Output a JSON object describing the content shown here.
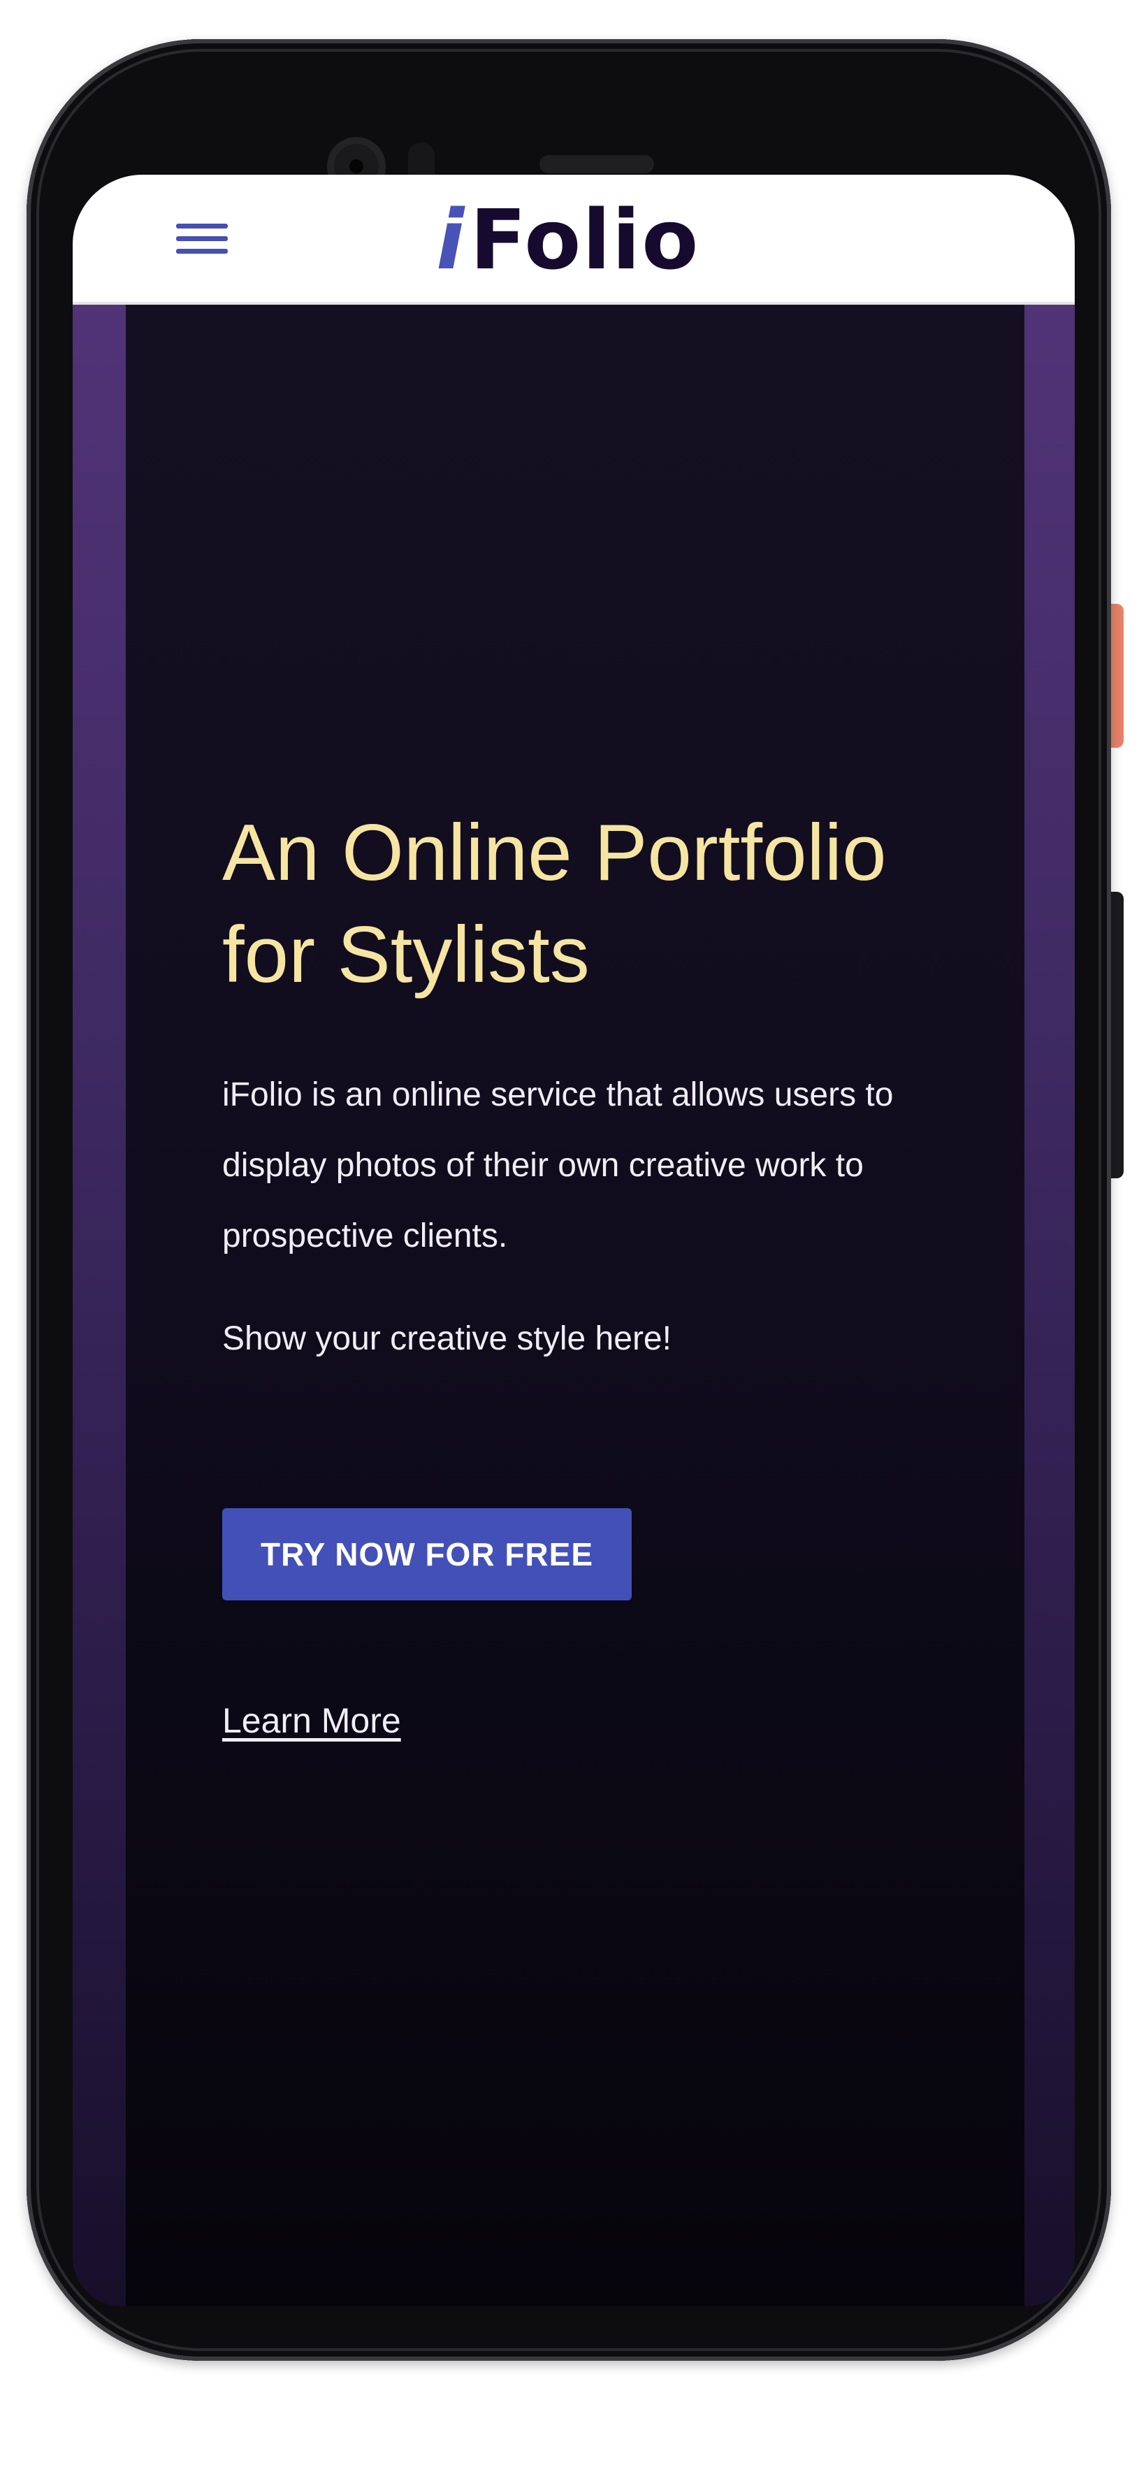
{
  "brand": {
    "logo_prefix": "i",
    "logo_rest": "Folio",
    "logo_prefix_color": "#4852b8",
    "logo_rest_color": "#160b2e"
  },
  "navbar": {
    "menu_icon": "hamburger-menu-icon",
    "menu_icon_color": "#4650b3"
  },
  "hero": {
    "title": "An Online Portfolio\nfor Stylists",
    "description": "iFolio is an online service that allows users to display photos of their own creative work to prospective clients.",
    "tagline": "Show your creative style here!",
    "cta_label": "TRY NOW FOR FREE",
    "learn_more_label": "Learn More",
    "title_color": "#f6e5a2",
    "cta_color": "#4350b8",
    "background_color": "#100c1d",
    "side_accent_color": "#54357a"
  }
}
